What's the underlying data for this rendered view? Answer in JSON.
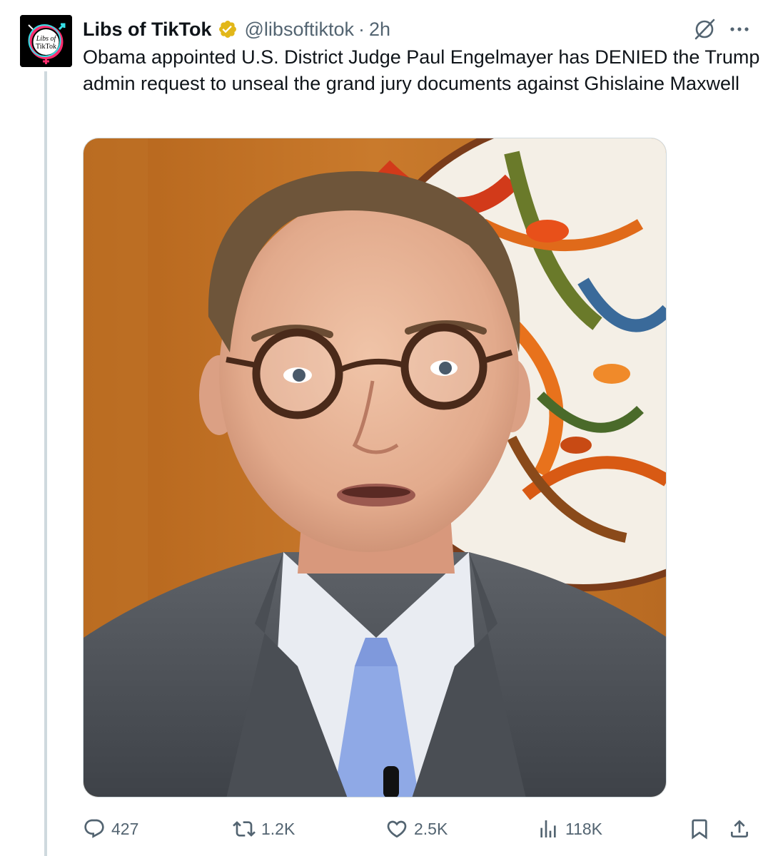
{
  "tweet": {
    "display_name": "Libs of TikTok",
    "handle": "@libsoftiktok",
    "separator": "·",
    "timestamp": "2h",
    "verified_color": "#e2b719",
    "avatar_text": "Libs of TikTok",
    "text": "Obama appointed U.S. District Judge Paul Engelmayer has DENIED the Trump admin request to unseal the grand jury documents against Ghislaine Maxwell"
  },
  "header_icons": {
    "grok": "grok-icon",
    "more": "more-icon"
  },
  "actions": {
    "reply": {
      "icon": "reply-icon",
      "count": "427"
    },
    "repost": {
      "icon": "repost-icon",
      "count": "1.2K"
    },
    "like": {
      "icon": "heart-icon",
      "count": "2.5K"
    },
    "views": {
      "icon": "views-icon",
      "count": "118K"
    },
    "bookmark": {
      "icon": "bookmark-icon"
    },
    "share": {
      "icon": "share-icon"
    }
  }
}
